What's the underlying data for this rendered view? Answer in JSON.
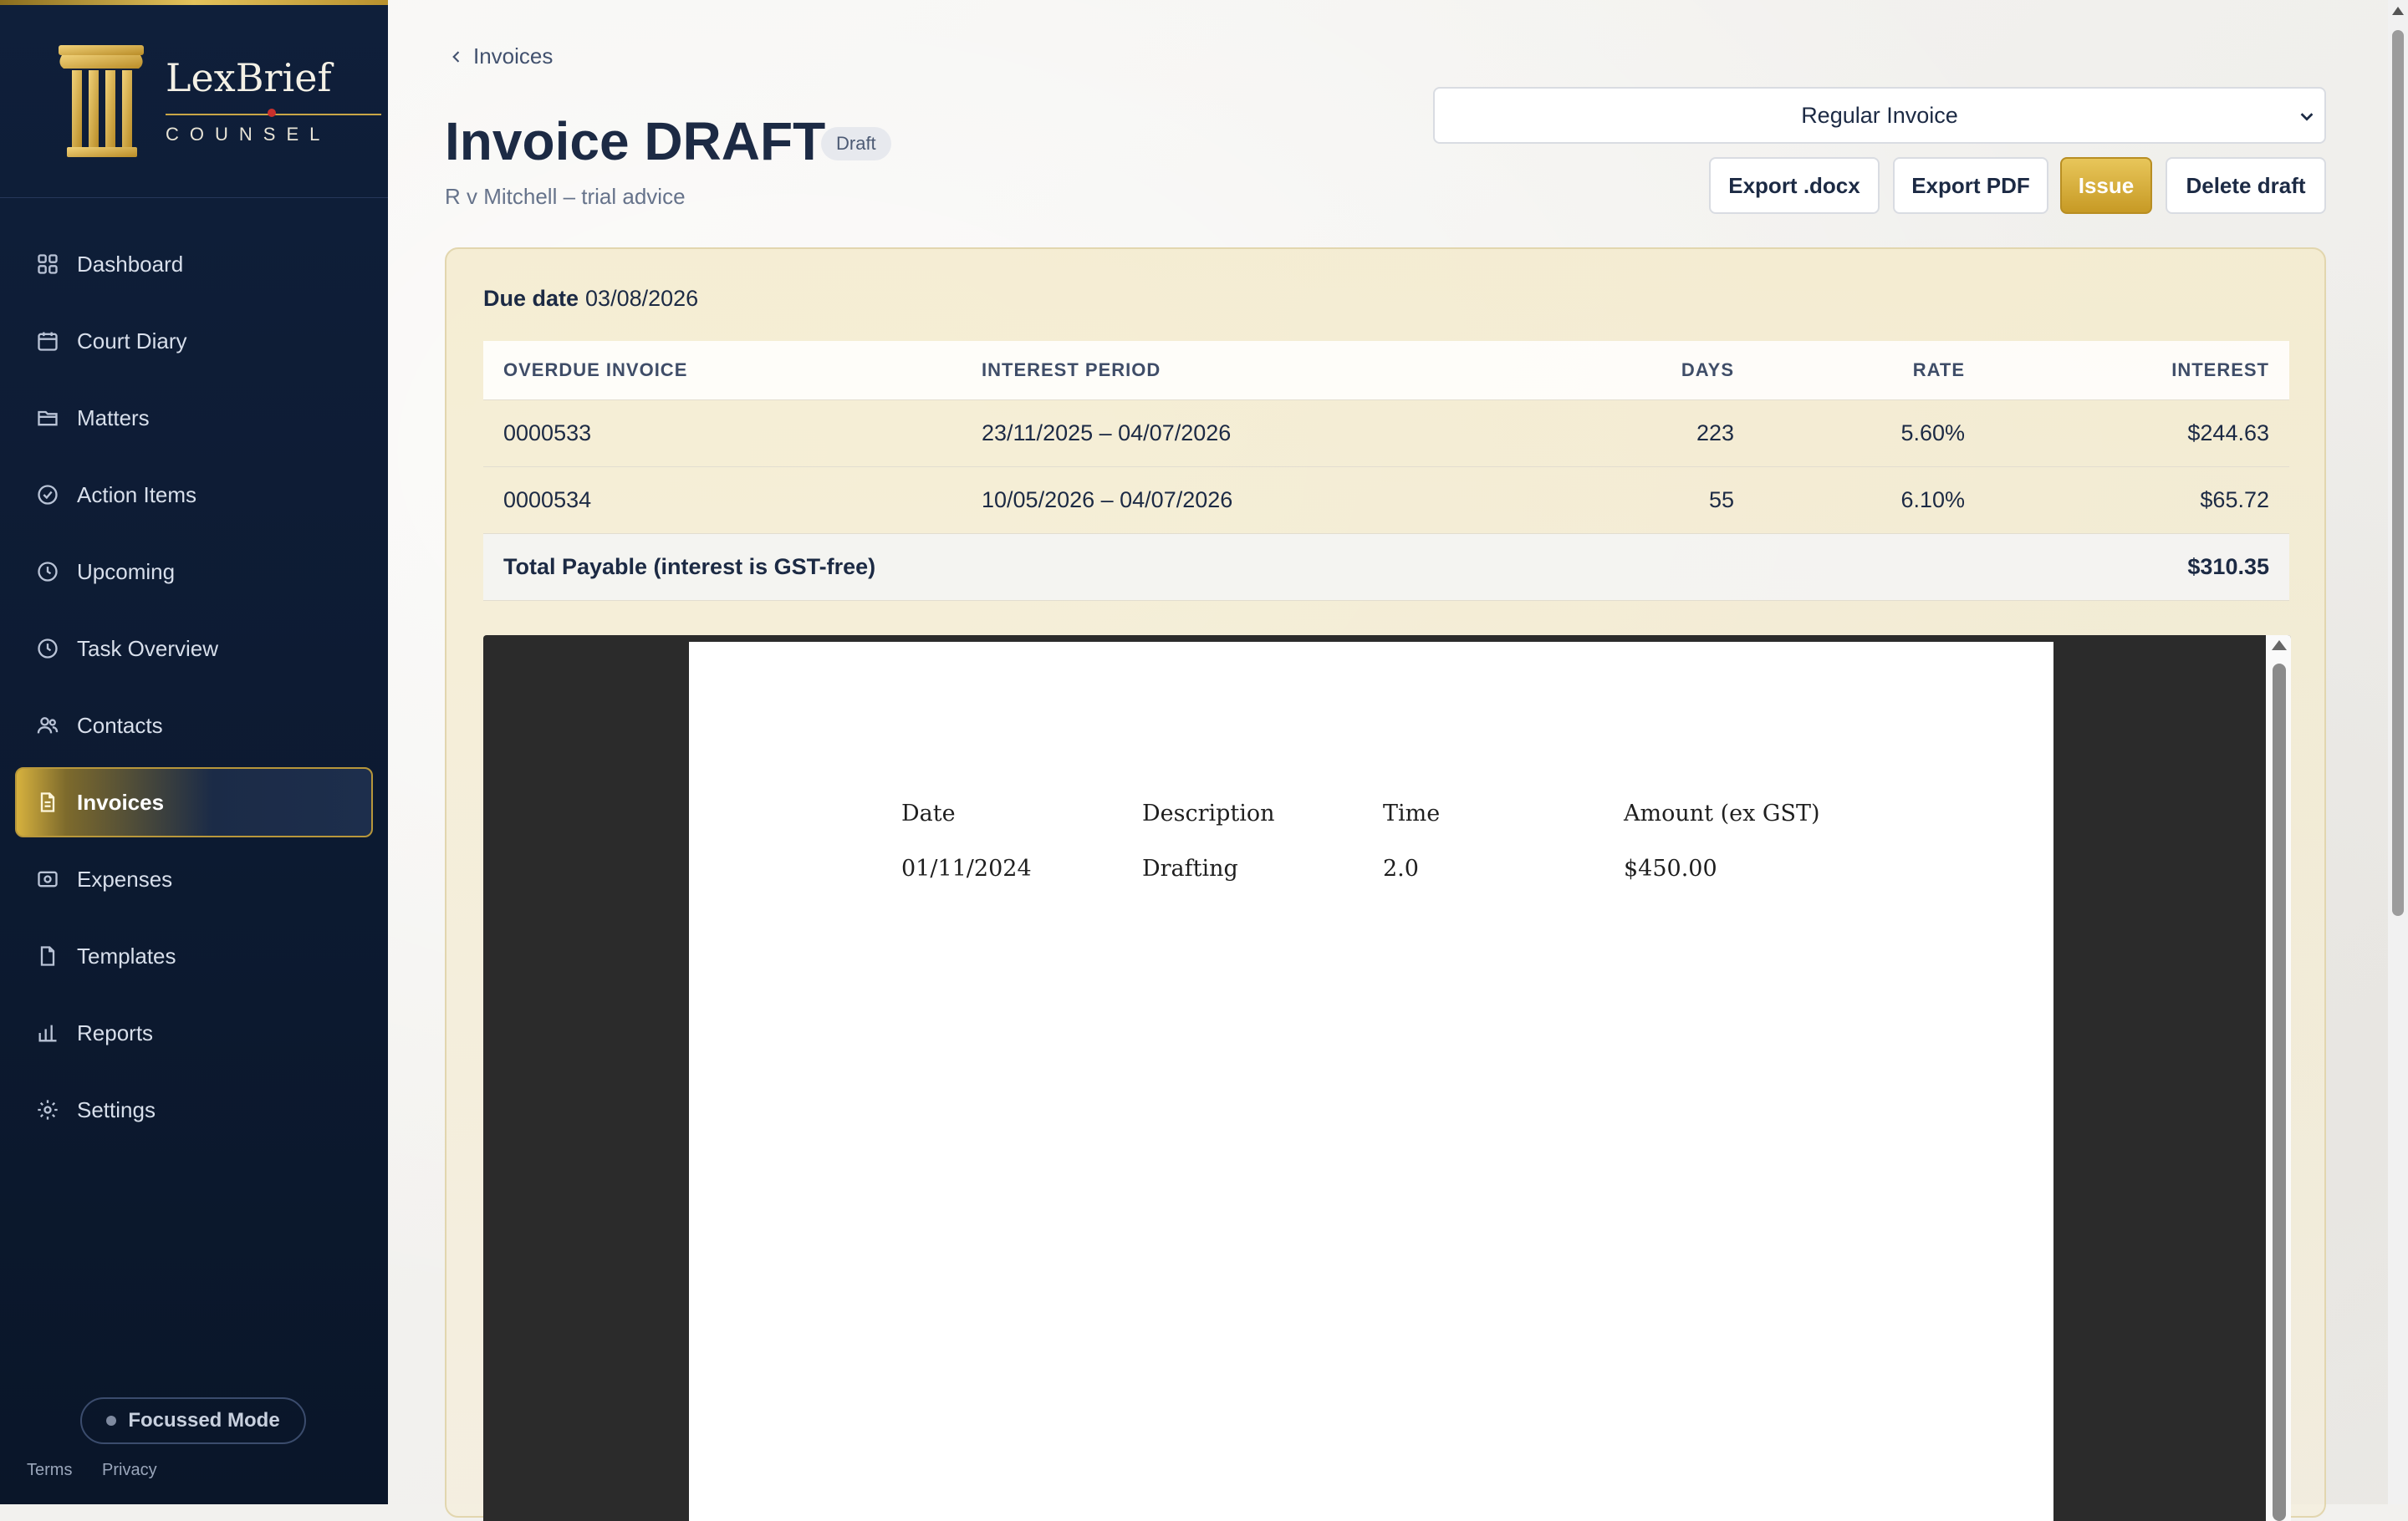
{
  "brand": {
    "name": "LexBrief",
    "tagline": "COUNSEL"
  },
  "sidebar": {
    "items": [
      {
        "label": "Dashboard",
        "icon": "dashboard-icon"
      },
      {
        "label": "Court Diary",
        "icon": "calendar-icon"
      },
      {
        "label": "Matters",
        "icon": "folder-icon"
      },
      {
        "label": "Action Items",
        "icon": "check-circle-icon"
      },
      {
        "label": "Upcoming",
        "icon": "clock-icon"
      },
      {
        "label": "Task Overview",
        "icon": "clock-icon"
      },
      {
        "label": "Contacts",
        "icon": "users-icon"
      },
      {
        "label": "Invoices",
        "icon": "document-icon",
        "active": true
      },
      {
        "label": "Expenses",
        "icon": "receipt-icon"
      },
      {
        "label": "Templates",
        "icon": "file-icon"
      },
      {
        "label": "Reports",
        "icon": "bar-chart-icon"
      },
      {
        "label": "Settings",
        "icon": "gear-icon"
      }
    ],
    "focus_mode": "Focussed Mode",
    "footer": {
      "terms": "Terms",
      "privacy": "Privacy"
    }
  },
  "breadcrumb": {
    "label": "Invoices"
  },
  "page": {
    "title": "Invoice DRAFT",
    "status_badge": "Draft",
    "subtitle": "R v Mitchell – trial advice"
  },
  "invoice_type": {
    "selected": "Regular Invoice"
  },
  "actions": {
    "export_docx": "Export .docx",
    "export_pdf": "Export PDF",
    "issue": "Issue",
    "delete_draft": "Delete draft"
  },
  "due": {
    "label": "Due date",
    "value": "03/08/2026"
  },
  "interest_table": {
    "headers": {
      "invoice": "OVERDUE INVOICE",
      "period": "INTEREST PERIOD",
      "days": "DAYS",
      "rate": "RATE",
      "interest": "INTEREST"
    },
    "rows": [
      {
        "invoice": "0000533",
        "period": "23/11/2025 – 04/07/2026",
        "days": "223",
        "rate": "5.60%",
        "interest": "$244.63"
      },
      {
        "invoice": "0000534",
        "period": "10/05/2026 – 04/07/2026",
        "days": "55",
        "rate": "6.10%",
        "interest": "$65.72"
      }
    ],
    "total_label": "Total Payable (interest is GST-free)",
    "total_value": "$310.35"
  },
  "preview": {
    "headers": {
      "date": "Date",
      "description": "Description",
      "time": "Time",
      "amount": "Amount (ex GST)"
    },
    "rows": [
      {
        "date": "01/11/2024",
        "description": "Drafting",
        "time": "2.0",
        "amount": "$450.00"
      }
    ]
  },
  "colors": {
    "accent_gold": "#d6b13e",
    "sidebar_bg": "#0f1f3a",
    "text_dark": "#1c2a44"
  }
}
